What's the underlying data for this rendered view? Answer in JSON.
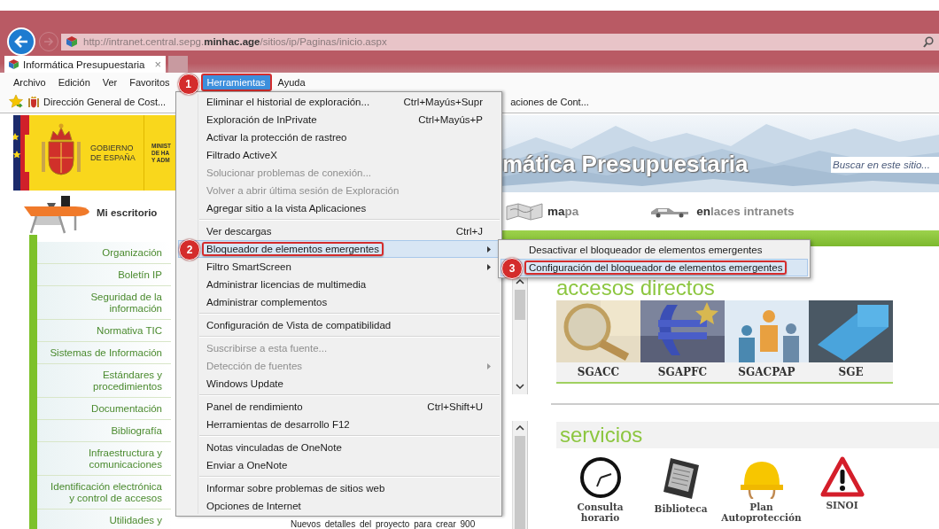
{
  "address_bar": {
    "url": "http://intranet.central.sepg.**minhac.age**/sitios/ip/Paginas/inicio.aspx"
  },
  "tabs": [
    {
      "label": "Informática Presupuestaria",
      "close": "×",
      "selected": true
    }
  ],
  "menu_bar": [
    {
      "label": "Archivo",
      "selected": false
    },
    {
      "label": "Edición",
      "selected": false
    },
    {
      "label": "Ver",
      "selected": false
    },
    {
      "label": "Favoritos",
      "selected": false
    },
    {
      "label": "Herramientas",
      "selected": true,
      "callout": "1"
    },
    {
      "label": "Ayuda",
      "selected": false
    }
  ],
  "favorites_bar": [
    {
      "label": "Dirección General de Cost..."
    },
    {
      "label": "aciones de Cont..."
    }
  ],
  "tools_menu": {
    "sections": [
      [
        {
          "label": "Eliminar el historial de exploración...",
          "shortcut": "Ctrl+Mayús+Supr",
          "disabled": false,
          "submenu": false,
          "selected": false
        },
        {
          "label": "Exploración de InPrivate",
          "shortcut": "Ctrl+Mayús+P",
          "disabled": false,
          "submenu": false,
          "selected": false
        },
        {
          "label": "Activar la protección de rastreo",
          "disabled": false,
          "submenu": false,
          "selected": false
        },
        {
          "label": "Filtrado ActiveX",
          "disabled": false,
          "submenu": false,
          "selected": false
        },
        {
          "label": "Solucionar problemas de conexión...",
          "disabled": true,
          "submenu": false,
          "selected": false
        },
        {
          "label": "Volver a abrir última sesión de Exploración",
          "disabled": true,
          "submenu": false,
          "selected": false
        },
        {
          "label": "Agregar sitio a la vista Aplicaciones",
          "disabled": false,
          "submenu": false,
          "selected": false
        }
      ],
      [
        {
          "label": "Ver descargas",
          "shortcut": "Ctrl+J",
          "disabled": false,
          "submenu": false,
          "selected": false
        },
        {
          "label": "Bloqueador de elementos emergentes",
          "disabled": false,
          "submenu": true,
          "selected": true,
          "callout": "2"
        },
        {
          "label": "Filtro SmartScreen",
          "disabled": false,
          "submenu": true,
          "selected": false
        },
        {
          "label": "Administrar licencias de multimedia",
          "disabled": false,
          "submenu": false,
          "selected": false
        },
        {
          "label": "Administrar complementos",
          "disabled": false,
          "submenu": false,
          "selected": false
        }
      ],
      [
        {
          "label": "Configuración de Vista de compatibilidad",
          "disabled": false,
          "submenu": false,
          "selected": false
        }
      ],
      [
        {
          "label": "Suscribirse a esta fuente...",
          "disabled": true,
          "submenu": false,
          "selected": false
        },
        {
          "label": "Detección de fuentes",
          "disabled": true,
          "submenu": true,
          "selected": false
        },
        {
          "label": "Windows Update",
          "disabled": false,
          "submenu": false,
          "selected": false
        }
      ],
      [
        {
          "label": "Panel de rendimiento",
          "shortcut": "Ctrl+Shift+U",
          "disabled": false,
          "submenu": false,
          "selected": false
        },
        {
          "label": "Herramientas de desarrollo F12",
          "disabled": false,
          "submenu": false,
          "selected": false
        }
      ],
      [
        {
          "label": "Notas vinculadas de OneNote",
          "disabled": false,
          "submenu": false,
          "selected": false
        },
        {
          "label": "Enviar a OneNote",
          "disabled": false,
          "submenu": false,
          "selected": false
        }
      ],
      [
        {
          "label": "Informar sobre problemas de sitios web",
          "disabled": false,
          "submenu": false,
          "selected": false
        },
        {
          "label": "Opciones de Internet",
          "disabled": false,
          "submenu": false,
          "selected": false
        }
      ]
    ]
  },
  "submenu": {
    "items": [
      {
        "label": "Desactivar el bloqueador de elementos emergentes",
        "selected": false
      },
      {
        "label": "Configuración del bloqueador de elementos emergentes",
        "selected": true,
        "callout": "3"
      }
    ]
  },
  "site": {
    "logo": {
      "government": "GOBIERNO\nDE ESPAÑA",
      "ministry": "MINIST\nDE HA\nY ADM"
    },
    "desk_link": "Mi escritorio",
    "sidebar": [
      "Organización",
      "Boletín IP",
      "Seguridad de la\ninformación",
      "Normativa TIC",
      "Sistemas de Información",
      "Estándares y\nprocedimientos",
      "Documentación",
      "Bibliografía",
      "Infraestructura y\ncomunicaciones",
      "Identificación electrónica\ny control de accesos",
      "Utilidades y"
    ],
    "title": "mática Presupuestaria",
    "search": {
      "placeholder": "Buscar en este sitio..."
    },
    "nav_links": [
      {
        "label": "**ma**pa",
        "kind": "map"
      },
      {
        "label": "**en**laces intranets",
        "kind": "car"
      }
    ],
    "shortcuts": {
      "heading": "accesos directos",
      "tiles": [
        {
          "label": "SGACC"
        },
        {
          "label": "SGAPFC"
        },
        {
          "label": "SGACPAP"
        },
        {
          "label": "SGE"
        }
      ]
    },
    "services": {
      "heading": "servicios",
      "items": [
        {
          "label": "Consulta\nhorario",
          "kind": "clock"
        },
        {
          "label": "Biblioteca",
          "kind": "ebook"
        },
        {
          "label": "Plan\nAutoprotección",
          "kind": "helmet"
        },
        {
          "label": "SINOI",
          "kind": "warning"
        }
      ]
    },
    "news_snippet": "Nuevos detalles del proyecto para crear 900"
  }
}
